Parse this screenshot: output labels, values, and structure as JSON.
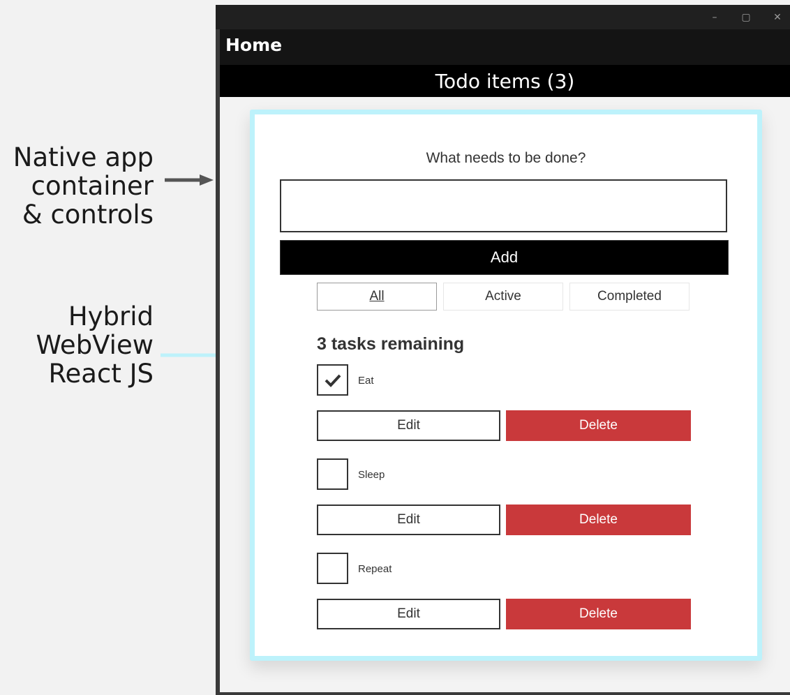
{
  "annotations": {
    "native": [
      "Native app",
      "container",
      "& controls"
    ],
    "hybrid": [
      "Hybrid",
      "WebView",
      "React JS"
    ]
  },
  "window": {
    "controls": {
      "minimize": "–",
      "maximize": "▢",
      "close": "✕"
    }
  },
  "navbar": {
    "title": "Home"
  },
  "page_header": {
    "title": "Todo items (3)"
  },
  "app": {
    "prompt": "What needs to be done?",
    "new_todo_value": "",
    "add_label": "Add",
    "filters": [
      {
        "label": "All",
        "selected": true
      },
      {
        "label": "Active",
        "selected": false
      },
      {
        "label": "Completed",
        "selected": false
      }
    ],
    "remaining_text": "3 tasks remaining",
    "todos": [
      {
        "label": "Eat",
        "completed": true,
        "edit_label": "Edit",
        "delete_label": "Delete"
      },
      {
        "label": "Sleep",
        "completed": false,
        "edit_label": "Edit",
        "delete_label": "Delete"
      },
      {
        "label": "Repeat",
        "completed": false,
        "edit_label": "Edit",
        "delete_label": "Delete"
      }
    ]
  },
  "colors": {
    "native_arrow": "#555555",
    "hybrid_arrow": "#bdf2fb",
    "webview_border": "#bdf2fb",
    "delete_red": "#c9393b"
  }
}
